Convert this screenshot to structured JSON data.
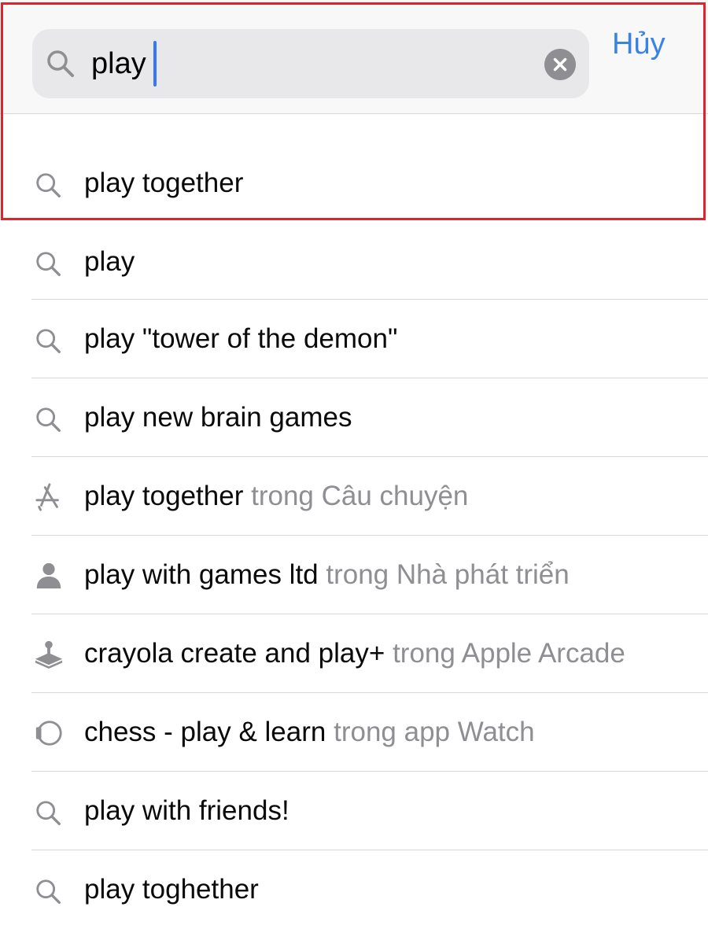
{
  "search": {
    "query": "play",
    "cancel_label": "Hủy"
  },
  "suggestions": [
    {
      "icon": "search-icon",
      "text": "play together",
      "context": ""
    },
    {
      "icon": "search-icon",
      "text": "play",
      "context": ""
    },
    {
      "icon": "search-icon",
      "text": "play \"tower of the demon\"",
      "context": ""
    },
    {
      "icon": "search-icon",
      "text": "play new brain games",
      "context": ""
    },
    {
      "icon": "app-store-icon",
      "text": "play together",
      "context": "trong Câu chuyện"
    },
    {
      "icon": "person-icon",
      "text": "play with games ltd",
      "context": "trong Nhà phát triển"
    },
    {
      "icon": "joystick-icon",
      "text": "crayola create and play+",
      "context": "trong Apple Arcade"
    },
    {
      "icon": "watch-icon",
      "text": "chess - play & learn",
      "context": "trong app Watch"
    },
    {
      "icon": "search-icon",
      "text": "play with friends!",
      "context": ""
    },
    {
      "icon": "search-icon",
      "text": "play toghether",
      "context": ""
    }
  ],
  "colors": {
    "accent": "#3a82e6",
    "caret": "#3478f6",
    "highlight": "#e0222a",
    "secondary_text": "#8e8e93"
  }
}
